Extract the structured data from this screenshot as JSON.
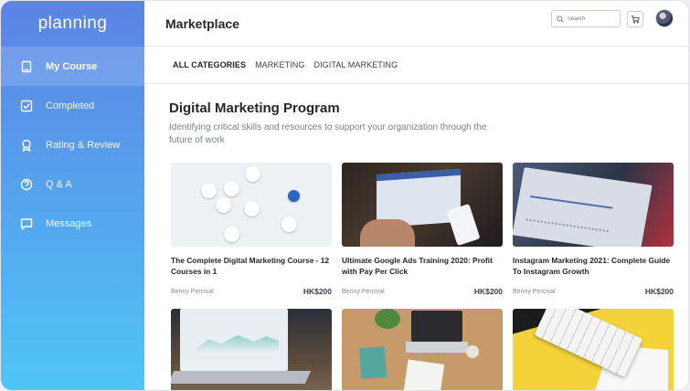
{
  "app": {
    "logo": "planning"
  },
  "sidebar": {
    "items": [
      {
        "label": "My Course",
        "icon": "book-icon",
        "active": true
      },
      {
        "label": "Completed",
        "icon": "checkbox-icon",
        "active": false
      },
      {
        "label": "Rating & Review",
        "icon": "award-icon",
        "active": false
      },
      {
        "label": "Q & A",
        "icon": "question-icon",
        "active": false
      },
      {
        "label": "Messages",
        "icon": "message-icon",
        "active": false
      }
    ]
  },
  "header": {
    "title": "Marketplace",
    "search_placeholder": "Search"
  },
  "tabs": [
    {
      "label": "ALL CATEGORIES",
      "active": true
    },
    {
      "label": "MARKETING",
      "active": false
    },
    {
      "label": "DIGITAL MARKETING",
      "active": false
    }
  ],
  "main": {
    "title": "Digital Marketing Program",
    "subtitle": "Identifying critical skills and resources to support your organization through the future of work"
  },
  "courses": [
    {
      "title": "The Complete Digital Marketing Course - 12 Courses in 1",
      "author": "Benny Percival",
      "price": "HK$200"
    },
    {
      "title": "Ultimate Google Ads Training 2020: Profit with Pay Per Click",
      "author": "Benny Percival",
      "price": "HK$200"
    },
    {
      "title": "Instagram Marketing 2021: Complete Guide To Instagram Growth",
      "author": "Benny Percival",
      "price": "HK$200"
    }
  ],
  "colors": {
    "sidebar_top": "#5b83e4",
    "sidebar_bottom": "#4fc6f6",
    "facebook_blue": "#2c64c6"
  }
}
